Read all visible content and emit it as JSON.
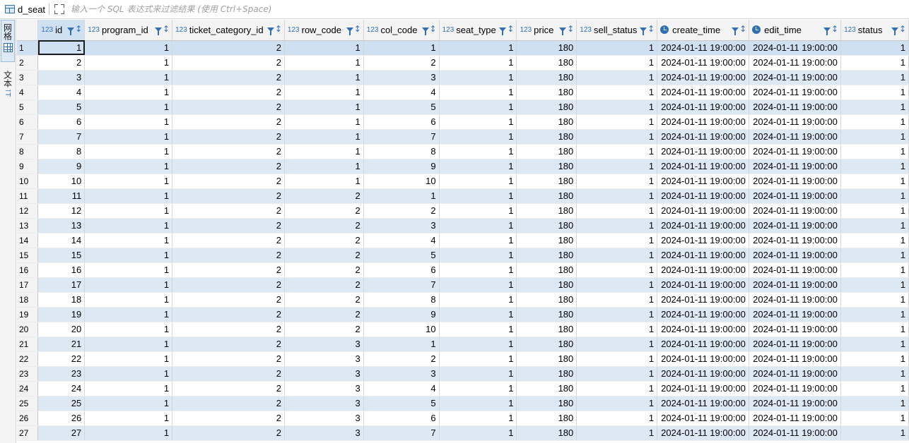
{
  "table_name": "d_seat",
  "filter": {
    "placeholder": "输入一个 SQL 表达式来过滤结果 (使用 Ctrl+Space)"
  },
  "side_tabs": {
    "grid_label": "网格",
    "text_label": "文本"
  },
  "colors": {
    "accent": "#2f6fb5",
    "row_alt": "#dde8f5",
    "selected": "#cfe0f3"
  },
  "columns": [
    {
      "key": "id",
      "label": "id",
      "type": "123"
    },
    {
      "key": "program_id",
      "label": "program_id",
      "type": "123"
    },
    {
      "key": "ticket_category_id",
      "label": "ticket_category_id",
      "type": "123"
    },
    {
      "key": "row_code",
      "label": "row_code",
      "type": "123"
    },
    {
      "key": "col_code",
      "label": "col_code",
      "type": "123"
    },
    {
      "key": "seat_type",
      "label": "seat_type",
      "type": "123"
    },
    {
      "key": "price",
      "label": "price",
      "type": "123"
    },
    {
      "key": "sell_status",
      "label": "sell_status",
      "type": "123"
    },
    {
      "key": "create_time",
      "label": "create_time",
      "type": "datetime"
    },
    {
      "key": "edit_time",
      "label": "edit_time",
      "type": "datetime"
    },
    {
      "key": "status",
      "label": "status",
      "type": "123"
    }
  ],
  "rows": [
    {
      "n": "1",
      "v": [
        "1",
        "1",
        "2",
        "1",
        "1",
        "1",
        "180",
        "1",
        "2024-01-11 19:00:00",
        "2024-01-11 19:00:00",
        "1"
      ]
    },
    {
      "n": "2",
      "v": [
        "2",
        "1",
        "2",
        "1",
        "2",
        "1",
        "180",
        "1",
        "2024-01-11 19:00:00",
        "2024-01-11 19:00:00",
        "1"
      ]
    },
    {
      "n": "3",
      "v": [
        "3",
        "1",
        "2",
        "1",
        "3",
        "1",
        "180",
        "1",
        "2024-01-11 19:00:00",
        "2024-01-11 19:00:00",
        "1"
      ]
    },
    {
      "n": "4",
      "v": [
        "4",
        "1",
        "2",
        "1",
        "4",
        "1",
        "180",
        "1",
        "2024-01-11 19:00:00",
        "2024-01-11 19:00:00",
        "1"
      ]
    },
    {
      "n": "5",
      "v": [
        "5",
        "1",
        "2",
        "1",
        "5",
        "1",
        "180",
        "1",
        "2024-01-11 19:00:00",
        "2024-01-11 19:00:00",
        "1"
      ]
    },
    {
      "n": "6",
      "v": [
        "6",
        "1",
        "2",
        "1",
        "6",
        "1",
        "180",
        "1",
        "2024-01-11 19:00:00",
        "2024-01-11 19:00:00",
        "1"
      ]
    },
    {
      "n": "7",
      "v": [
        "7",
        "1",
        "2",
        "1",
        "7",
        "1",
        "180",
        "1",
        "2024-01-11 19:00:00",
        "2024-01-11 19:00:00",
        "1"
      ]
    },
    {
      "n": "8",
      "v": [
        "8",
        "1",
        "2",
        "1",
        "8",
        "1",
        "180",
        "1",
        "2024-01-11 19:00:00",
        "2024-01-11 19:00:00",
        "1"
      ]
    },
    {
      "n": "9",
      "v": [
        "9",
        "1",
        "2",
        "1",
        "9",
        "1",
        "180",
        "1",
        "2024-01-11 19:00:00",
        "2024-01-11 19:00:00",
        "1"
      ]
    },
    {
      "n": "10",
      "v": [
        "10",
        "1",
        "2",
        "1",
        "10",
        "1",
        "180",
        "1",
        "2024-01-11 19:00:00",
        "2024-01-11 19:00:00",
        "1"
      ]
    },
    {
      "n": "11",
      "v": [
        "11",
        "1",
        "2",
        "2",
        "1",
        "1",
        "180",
        "1",
        "2024-01-11 19:00:00",
        "2024-01-11 19:00:00",
        "1"
      ]
    },
    {
      "n": "12",
      "v": [
        "12",
        "1",
        "2",
        "2",
        "2",
        "1",
        "180",
        "1",
        "2024-01-11 19:00:00",
        "2024-01-11 19:00:00",
        "1"
      ]
    },
    {
      "n": "13",
      "v": [
        "13",
        "1",
        "2",
        "2",
        "3",
        "1",
        "180",
        "1",
        "2024-01-11 19:00:00",
        "2024-01-11 19:00:00",
        "1"
      ]
    },
    {
      "n": "14",
      "v": [
        "14",
        "1",
        "2",
        "2",
        "4",
        "1",
        "180",
        "1",
        "2024-01-11 19:00:00",
        "2024-01-11 19:00:00",
        "1"
      ]
    },
    {
      "n": "15",
      "v": [
        "15",
        "1",
        "2",
        "2",
        "5",
        "1",
        "180",
        "1",
        "2024-01-11 19:00:00",
        "2024-01-11 19:00:00",
        "1"
      ]
    },
    {
      "n": "16",
      "v": [
        "16",
        "1",
        "2",
        "2",
        "6",
        "1",
        "180",
        "1",
        "2024-01-11 19:00:00",
        "2024-01-11 19:00:00",
        "1"
      ]
    },
    {
      "n": "17",
      "v": [
        "17",
        "1",
        "2",
        "2",
        "7",
        "1",
        "180",
        "1",
        "2024-01-11 19:00:00",
        "2024-01-11 19:00:00",
        "1"
      ]
    },
    {
      "n": "18",
      "v": [
        "18",
        "1",
        "2",
        "2",
        "8",
        "1",
        "180",
        "1",
        "2024-01-11 19:00:00",
        "2024-01-11 19:00:00",
        "1"
      ]
    },
    {
      "n": "19",
      "v": [
        "19",
        "1",
        "2",
        "2",
        "9",
        "1",
        "180",
        "1",
        "2024-01-11 19:00:00",
        "2024-01-11 19:00:00",
        "1"
      ]
    },
    {
      "n": "20",
      "v": [
        "20",
        "1",
        "2",
        "2",
        "10",
        "1",
        "180",
        "1",
        "2024-01-11 19:00:00",
        "2024-01-11 19:00:00",
        "1"
      ]
    },
    {
      "n": "21",
      "v": [
        "21",
        "1",
        "2",
        "3",
        "1",
        "1",
        "180",
        "1",
        "2024-01-11 19:00:00",
        "2024-01-11 19:00:00",
        "1"
      ]
    },
    {
      "n": "22",
      "v": [
        "22",
        "1",
        "2",
        "3",
        "2",
        "1",
        "180",
        "1",
        "2024-01-11 19:00:00",
        "2024-01-11 19:00:00",
        "1"
      ]
    },
    {
      "n": "23",
      "v": [
        "23",
        "1",
        "2",
        "3",
        "3",
        "1",
        "180",
        "1",
        "2024-01-11 19:00:00",
        "2024-01-11 19:00:00",
        "1"
      ]
    },
    {
      "n": "24",
      "v": [
        "24",
        "1",
        "2",
        "3",
        "4",
        "1",
        "180",
        "1",
        "2024-01-11 19:00:00",
        "2024-01-11 19:00:00",
        "1"
      ]
    },
    {
      "n": "25",
      "v": [
        "25",
        "1",
        "2",
        "3",
        "5",
        "1",
        "180",
        "1",
        "2024-01-11 19:00:00",
        "2024-01-11 19:00:00",
        "1"
      ]
    },
    {
      "n": "26",
      "v": [
        "26",
        "1",
        "2",
        "3",
        "6",
        "1",
        "180",
        "1",
        "2024-01-11 19:00:00",
        "2024-01-11 19:00:00",
        "1"
      ]
    },
    {
      "n": "27",
      "v": [
        "27",
        "1",
        "2",
        "3",
        "7",
        "1",
        "180",
        "1",
        "2024-01-11 19:00:00",
        "2024-01-11 19:00:00",
        "1"
      ]
    }
  ]
}
